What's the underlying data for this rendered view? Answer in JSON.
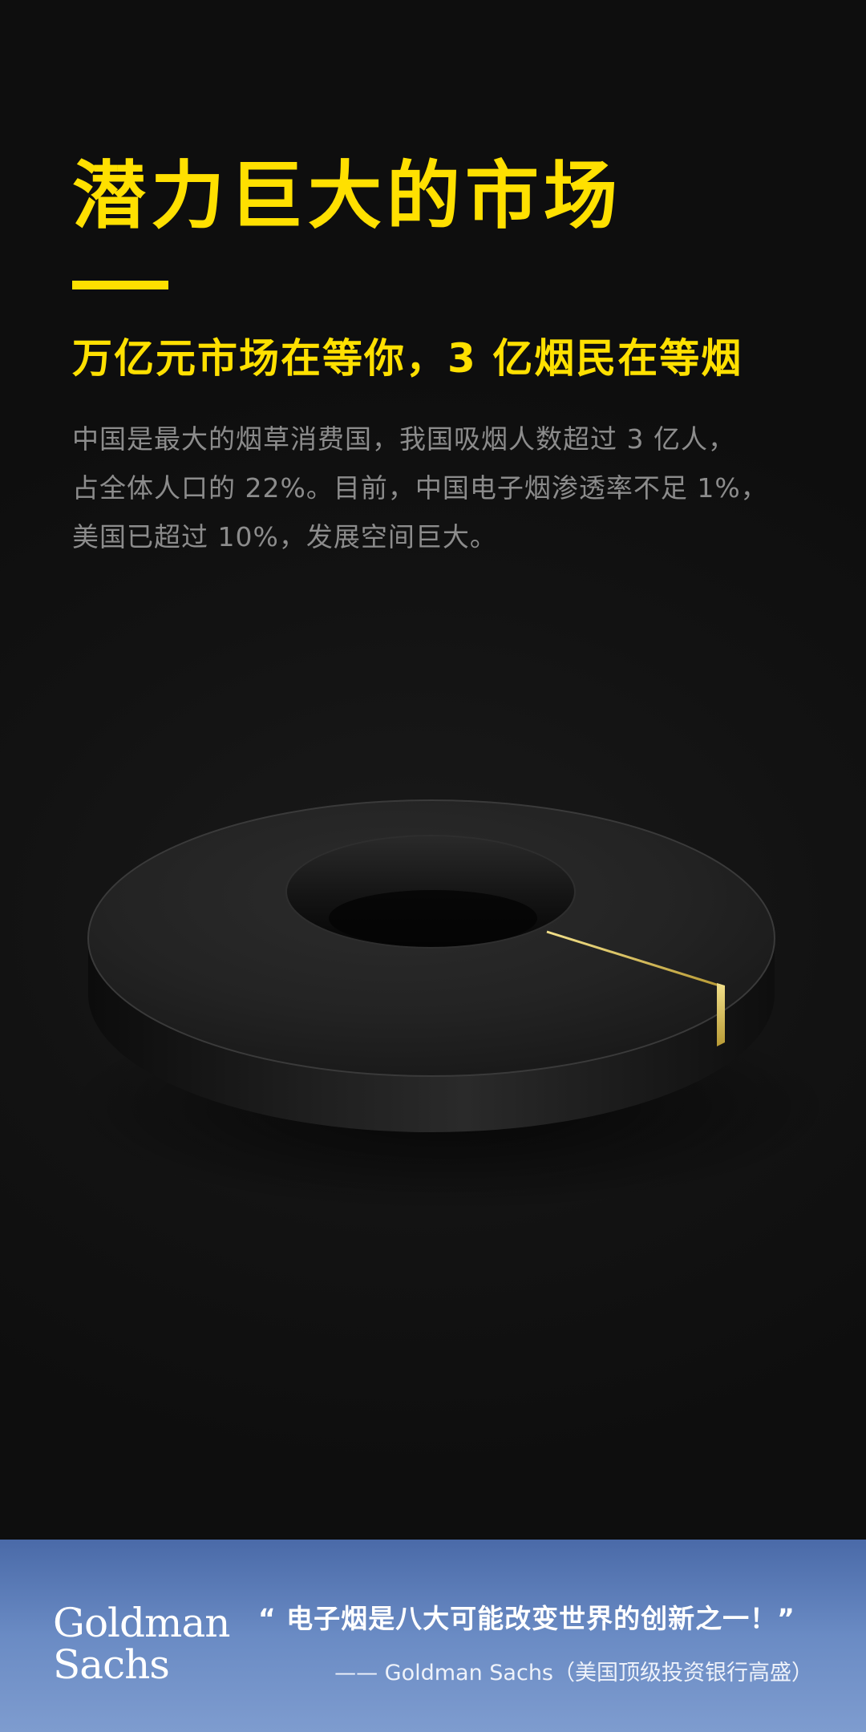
{
  "header": {
    "title": "潜力巨大的市场",
    "subtitle": "万亿元市场在等你，3 亿烟民在等烟"
  },
  "body": {
    "lines": [
      "中国是最大的烟草消费国，我国吸烟人数超过 3 亿人，",
      "占全体人口的 22%。目前，中国电子烟渗透率不足 1%，",
      "美国已超过 10%，发展空间巨大。"
    ]
  },
  "illustration": {
    "penetration_highlight_percent": 1,
    "colors": {
      "ring": "#1c1c1c",
      "highlight": "#d9c35a"
    }
  },
  "footer": {
    "logo_lines": [
      "Goldman",
      "Sachs"
    ],
    "quote": "“ 电子烟是八大可能改变世界的创新之一！”",
    "attribution": "—— Goldman Sachs（美国顶级投资银行高盛）"
  },
  "colors": {
    "accent": "#FFE000",
    "background": "#121212",
    "body_text": "#8c8c8c",
    "footer_blue": "#5a7bb8"
  }
}
